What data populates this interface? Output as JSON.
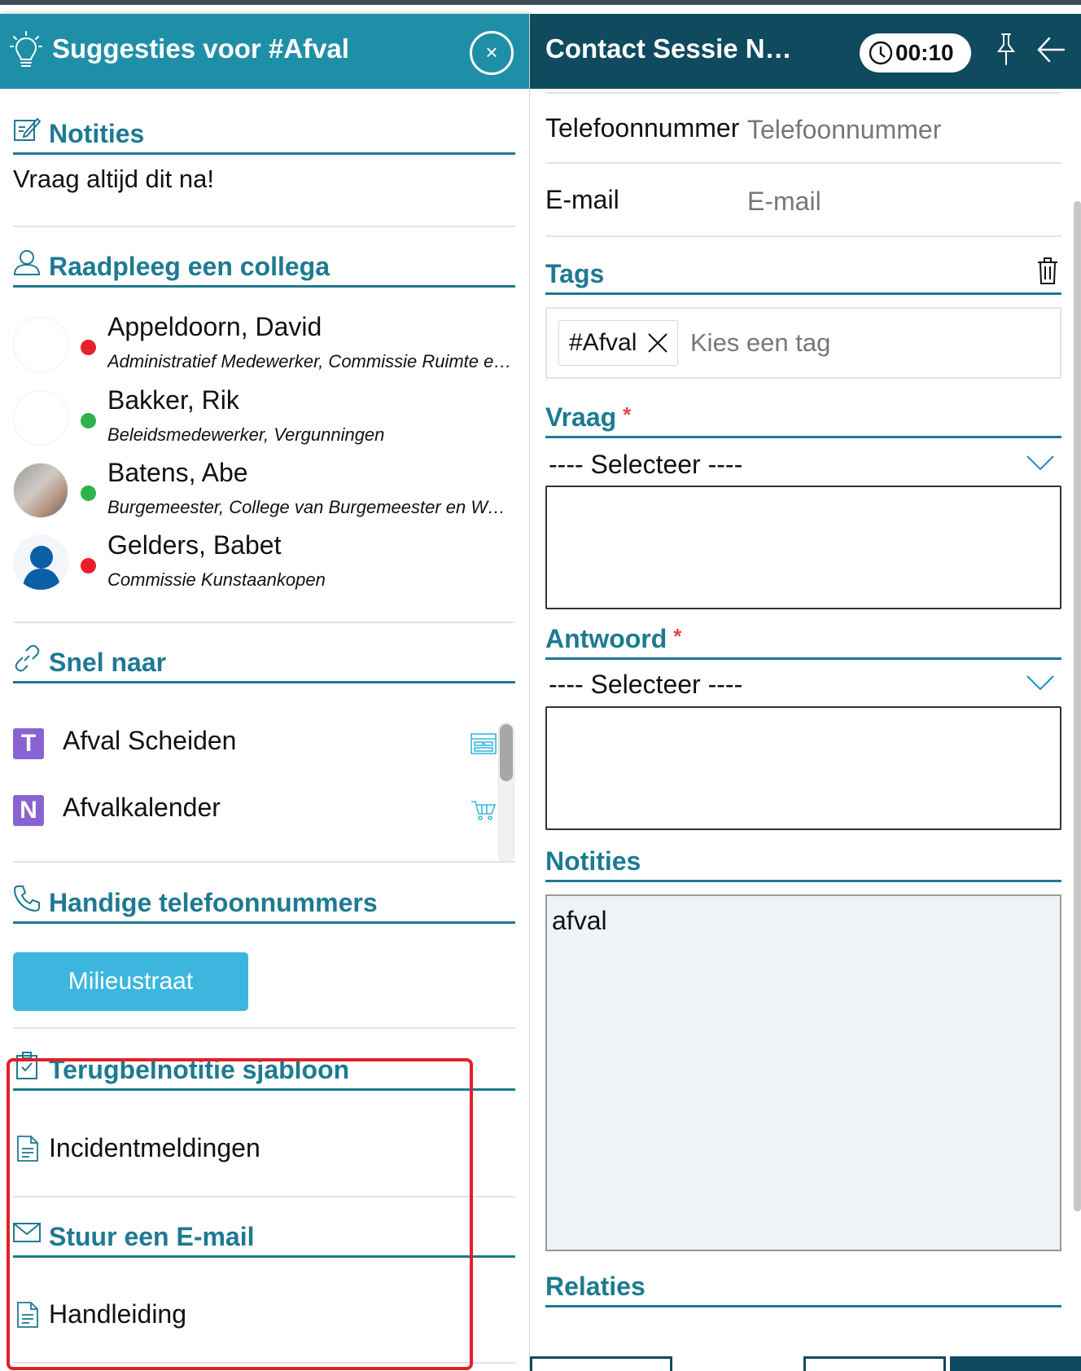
{
  "left_panel": {
    "title": "Suggesties voor #Afval",
    "close_label": "×",
    "notities": {
      "heading": "Notities",
      "text": "Vraag altijd dit na!"
    },
    "colleagues": {
      "heading": "Raadpleeg een collega",
      "people": [
        {
          "name": "Appeldoorn, David",
          "role": "Administratief Medewerker, Commissie Ruimte en Milieu",
          "status": "offline",
          "status_color": "#e8202a"
        },
        {
          "name": "Bakker, Rik",
          "role": "Beleidsmedewerker, Vergunningen",
          "status": "online",
          "status_color": "#2db34a"
        },
        {
          "name": "Batens, Abe",
          "role": "Burgemeester, College van Burgemeester en Wethouders",
          "status": "online",
          "status_color": "#2db34a"
        },
        {
          "name": "Gelders, Babet",
          "role": "Commissie Kunstaankopen",
          "status": "offline",
          "status_color": "#e8202a"
        }
      ]
    },
    "snel_naar": {
      "heading": "Snel naar",
      "items": [
        {
          "badge": "T",
          "label": "Afval Scheiden",
          "icon": "form-icon"
        },
        {
          "badge": "N",
          "label": "Afvalkalender",
          "icon": "cart-icon"
        }
      ]
    },
    "telefoonnummers": {
      "heading": "Handige telefoonnummers",
      "button_label": "Milieustraat"
    },
    "terugbel": {
      "heading": "Terugbelnotitie sjabloon",
      "item": "Incidentmeldingen"
    },
    "email": {
      "heading": "Stuur een E-mail",
      "item": "Handleiding"
    }
  },
  "right_panel": {
    "title": "Contact Sessie N…",
    "timer": "00:10",
    "telefoon": {
      "label": "Telefoonnummer",
      "placeholder": "Telefoonnummer"
    },
    "email": {
      "label": "E-mail",
      "placeholder": "E-mail"
    },
    "tags": {
      "heading": "Tags",
      "chip": "#Afval",
      "placeholder": "Kies een tag"
    },
    "vraag": {
      "heading": "Vraag",
      "required": "*",
      "select_value": "---- Selecteer ----"
    },
    "antwoord": {
      "heading": "Antwoord",
      "required": "*",
      "select_value": "---- Selecteer ----"
    },
    "notities": {
      "heading": "Notities",
      "value": "afval"
    },
    "relaties": {
      "heading": "Relaties"
    }
  },
  "colors": {
    "left_header": "#1f8fa8",
    "right_header": "#0f4a5f",
    "section_accent": "#1d7a91",
    "button": "#3cb6df",
    "badge": "#8a63d2",
    "highlight": "#e41f26"
  }
}
